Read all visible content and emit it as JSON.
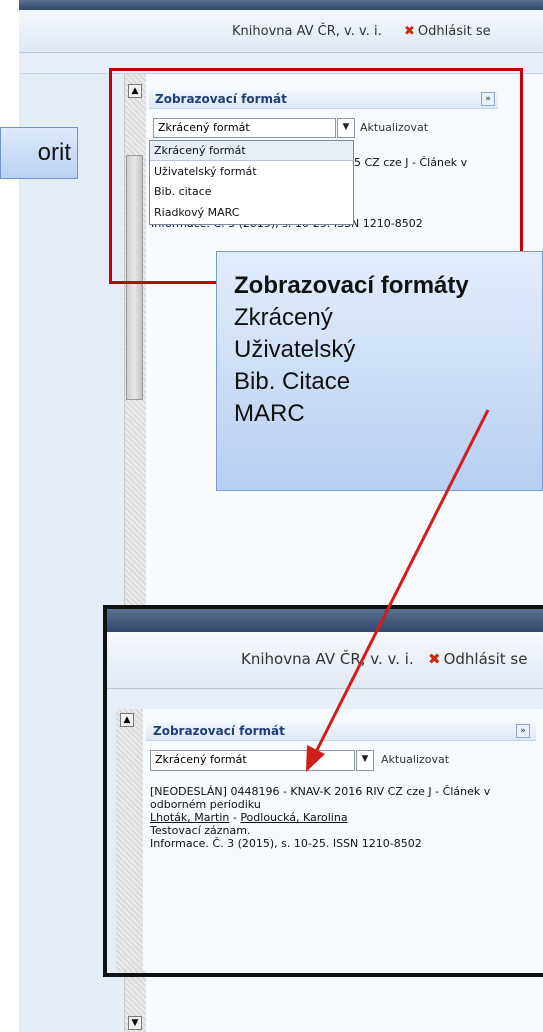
{
  "header": {
    "library_name": "Knihovna AV ČR, v. v. i.",
    "logout_label": "Odhlásit se"
  },
  "left_callout": {
    "text": "orit"
  },
  "panel": {
    "title": "Zobrazovací formát",
    "collapse_icon": "»",
    "select_value": "Zkrácený formát",
    "refresh_label": "Aktualizovat",
    "options": [
      "Zkrácený formát",
      "Uživatelský formát",
      "Bib. citace",
      "Riadkový MARC"
    ]
  },
  "record_partial": {
    "line1_end": "5 CZ cze J - Článek v",
    "line4": "Informace. Č. 3 (2015), s. 10-25. ISSN 1210-8502"
  },
  "callout": {
    "title": "Zobrazovací formáty",
    "items": [
      "Zkrácený",
      "Uživatelský",
      "Bib. Citace",
      "MARC"
    ]
  },
  "inset": {
    "library_name": "Knihovna AV ČR, v. v. i.",
    "logout_label": "Odhlásit se",
    "panel_title": "Zobrazovací formát",
    "select_value": "Zkrácený formát",
    "refresh_label": "Aktualizovat",
    "record": {
      "line1": "[NEODESLÁN] 0448196 - KNAV-K 2016 RIV CZ cze J - Článek v",
      "line2": "odborném periodiku",
      "author1": "Lhoták, Martin",
      "separator": " - ",
      "author2": "Podloucká, Karolina",
      "line4": "Testovací záznam.",
      "line5": "Informace. Č. 3 (2015), s. 10-25. ISSN 1210-8502"
    }
  },
  "scroll": {
    "up_arrow": "▲",
    "down_arrow": "▼"
  },
  "colors": {
    "accent": "#c00000",
    "arrow": "#d21d1d",
    "title_text": "#1d3f7a"
  }
}
